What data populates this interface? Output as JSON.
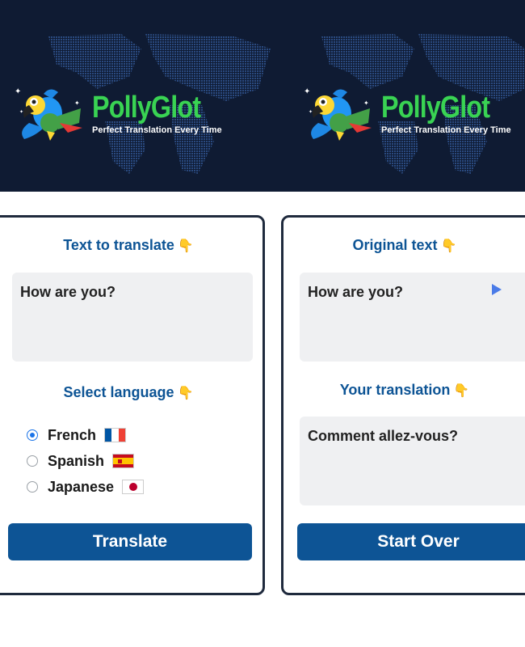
{
  "header": {
    "brand_name": "PollyGlot",
    "tagline": "Perfect Translation Every Time"
  },
  "colors": {
    "banner_bg": "#0f1b33",
    "brand_green": "#39d353",
    "heading_blue": "#0d5495",
    "button_blue": "#0d5495",
    "textbox_bg": "#eff0f2"
  },
  "left_card": {
    "text_heading": "Text to translate",
    "text_value": "How are you?",
    "language_heading": "Select language",
    "languages": [
      {
        "label": "French",
        "flag": "france-flag-icon",
        "selected": true
      },
      {
        "label": "Spanish",
        "flag": "spain-flag-icon",
        "selected": false
      },
      {
        "label": "Japanese",
        "flag": "japan-flag-icon",
        "selected": false
      }
    ],
    "button_label": "Translate"
  },
  "right_card": {
    "original_heading": "Original text",
    "original_value": "How are you?",
    "translation_heading": "Your translation",
    "translation_value": "Comment allez-vous?",
    "button_label": "Start Over"
  }
}
